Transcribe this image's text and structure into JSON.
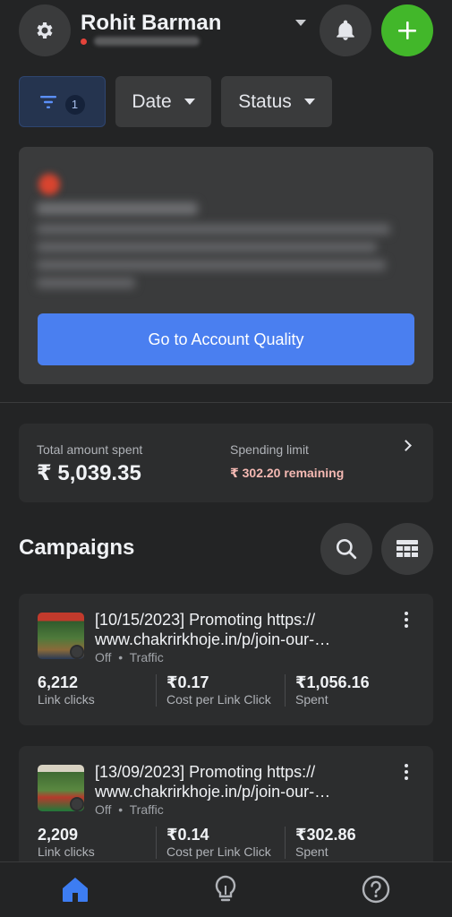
{
  "header": {
    "account_name": "Rohit Barman",
    "settings_icon": "gear-icon",
    "notifications_icon": "bell-icon",
    "create_icon": "plus-icon"
  },
  "filters": {
    "filter_count": "1",
    "date_label": "Date",
    "status_label": "Status"
  },
  "alert": {
    "button_label": "Go to Account Quality"
  },
  "spending": {
    "total_label": "Total amount spent",
    "total_value": "₹ 5,039.35",
    "limit_label": "Spending limit",
    "limit_remaining": "₹ 302.20 remaining"
  },
  "campaigns": {
    "title": "Campaigns",
    "items": [
      {
        "title": "[10/15/2023] Promoting https:// www.chakrirkhoje.in/p/join-our-…",
        "status": "Off",
        "objective": "Traffic",
        "link_clicks": "6,212",
        "link_clicks_label": "Link clicks",
        "cost_per_click": "₹0.17",
        "cost_per_click_label": "Cost per Link Click",
        "spent": "₹1,056.16",
        "spent_label": "Spent"
      },
      {
        "title": "[13/09/2023] Promoting https:// www.chakrirkhoje.in/p/join-our-…",
        "status": "Off",
        "objective": "Traffic",
        "link_clicks": "2,209",
        "link_clicks_label": "Link clicks",
        "cost_per_click": "₹0.14",
        "cost_per_click_label": "Cost per Link Click",
        "spent": "₹302.86",
        "spent_label": "Spent"
      }
    ]
  },
  "bottom_nav": {
    "items": [
      "home-icon",
      "lightbulb-icon",
      "help-icon"
    ]
  },
  "colors": {
    "background": "#232425",
    "card": "#2c2d2e",
    "accent_blue": "#4a7ff0",
    "create_green": "#42b72a",
    "warning_text": "#f5b9b3"
  }
}
